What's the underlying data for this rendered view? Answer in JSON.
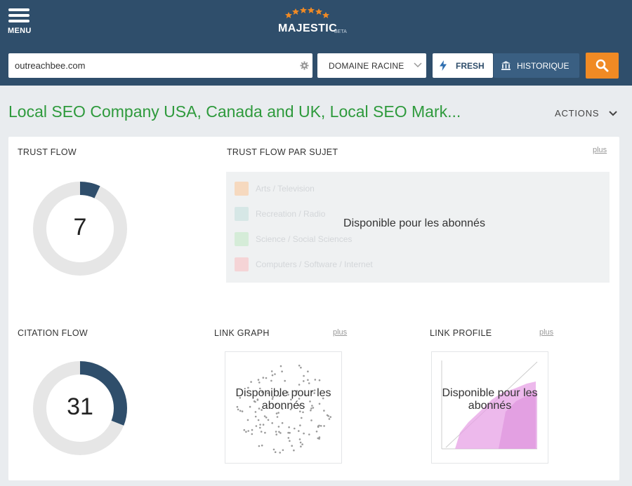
{
  "header": {
    "menu_label": "MENU",
    "logo_text": "MAJESTIC",
    "logo_badge": "BETA"
  },
  "search": {
    "value": "outreachbee.com",
    "placeholder": "",
    "settings_icon": "gear-icon",
    "scope_selected": "DOMAINE RACINE",
    "fresh_label": "FRESH",
    "fresh_icon": "lightning-icon",
    "historique_label": "HISTORIQUE",
    "historique_icon": "bank-icon",
    "submit_icon": "search-icon"
  },
  "page": {
    "title": "Local SEO Company USA, Canada and UK, Local SEO Mark...",
    "actions_label": "ACTIONS"
  },
  "trust_flow": {
    "title": "TRUST FLOW",
    "value": "7",
    "fraction": 0.07
  },
  "topical_trust_flow": {
    "title": "TRUST FLOW PAR SUJET",
    "plus_label": "plus",
    "topics": [
      {
        "label": "Arts / Television",
        "color": "#f6d9bf"
      },
      {
        "label": "Recreation / Radio",
        "color": "#d6e7e6"
      },
      {
        "label": "Science / Social Sciences",
        "color": "#d5ecd8"
      },
      {
        "label": "Computers / Software / Internet",
        "color": "#f5d4d6"
      }
    ],
    "overlay_message": "Disponible pour les abonnés"
  },
  "citation_flow": {
    "title": "CITATION FLOW",
    "value": "31",
    "fraction": 0.31
  },
  "link_graph": {
    "title": "LINK GRAPH",
    "plus_label": "plus",
    "overlay_line1": "Disponible pour les",
    "overlay_line2": "abonnés"
  },
  "link_profile": {
    "title": "LINK PROFILE",
    "plus_label": "plus",
    "overlay_line1": "Disponible pour les",
    "overlay_line2": "abonnés"
  },
  "colors": {
    "header_bg": "#2f4e6b",
    "title_green": "#2e9a3c",
    "donut_fill": "#2f4e6b",
    "donut_track": "#e6e6e6",
    "search_orange": "#f08a24"
  }
}
